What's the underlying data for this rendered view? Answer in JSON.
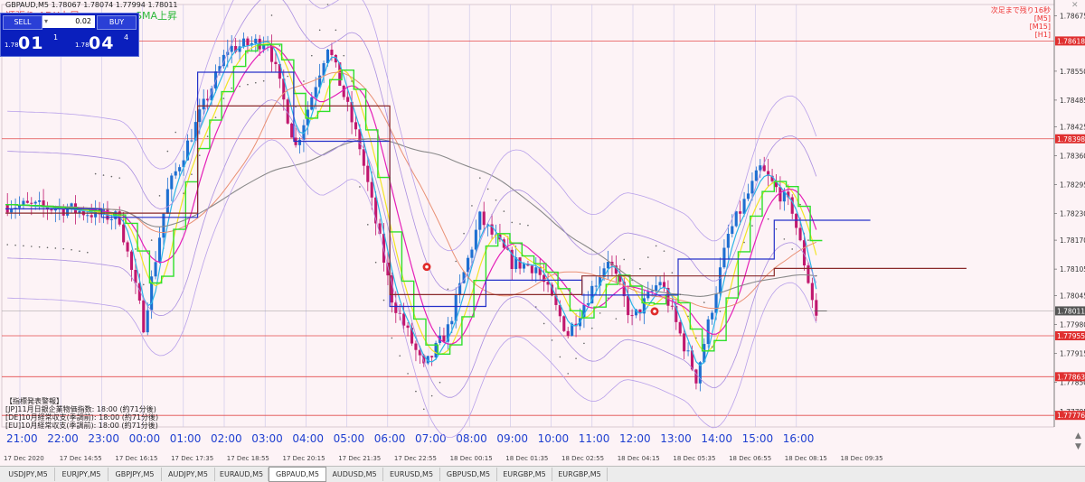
{
  "window": {
    "title": "GBPAUD,M5  1.78067 1.78074 1.77994 1.78011",
    "indicator_label_left": "順張り ADX上昇",
    "indicator_label_right": "SMA上昇",
    "countdown_lines": [
      "次足まで残り16秒",
      "[M5]",
      "[M15]",
      "[H1]"
    ]
  },
  "trade_panel": {
    "sell_label": "SELL",
    "buy_label": "BUY",
    "lot_value": "0.02",
    "sell_small": "1.78",
    "sell_big": "01",
    "sell_sup": "1",
    "buy_small": "1.78",
    "buy_big": "04",
    "buy_sup": "4"
  },
  "price_axis": {
    "ticks": [
      "1.78675",
      "1.78550",
      "1.78485",
      "1.78425",
      "1.78360",
      "1.78295",
      "1.78230",
      "1.78170",
      "1.78105",
      "1.78045",
      "1.77980",
      "1.77915",
      "1.77850",
      "1.77785"
    ],
    "labels": [
      {
        "text": "1.78618",
        "color": "#e03030"
      },
      {
        "text": "1.78398",
        "color": "#e03030"
      },
      {
        "text": "1.78011",
        "color": "#555555"
      },
      {
        "text": "1.77955",
        "color": "#e03030"
      },
      {
        "text": "1.77863",
        "color": "#e03030"
      },
      {
        "text": "1.77776",
        "color": "#e03030"
      }
    ]
  },
  "time_axis": {
    "hours": [
      "21:00",
      "22:00",
      "23:00",
      "00:00",
      "01:00",
      "02:00",
      "03:00",
      "04:00",
      "05:00",
      "06:00",
      "07:00",
      "08:00",
      "09:00",
      "10:00",
      "11:00",
      "12:00",
      "13:00",
      "14:00",
      "15:00",
      "16:00"
    ],
    "dates": [
      "17 Dec 2020",
      "17 Dec 14:55",
      "17 Dec 16:15",
      "17 Dec 17:35",
      "17 Dec 18:55",
      "17 Dec 20:15",
      "17 Dec 21:35",
      "17 Dec 22:55",
      "18 Dec 00:15",
      "18 Dec 01:35",
      "18 Dec 02:55",
      "18 Dec 04:15",
      "18 Dec 05:35",
      "18 Dec 06:55",
      "18 Dec 08:15",
      "18 Dec 09:35"
    ]
  },
  "news": {
    "title": "【指標発表警報】",
    "lines": [
      "[JP]11月日銀企業物価指数: 18:00 (約71分後)",
      "[DE]10月経常収支(季調前): 18:00 (約71分後)",
      "[EU]10月経常収支(季調前): 18:00 (約71分後)"
    ]
  },
  "tabs": [
    "USDJPY,M5",
    "EURJPY,M5",
    "GBPJPY,M5",
    "AUDJPY,M5",
    "EURAUD,M5",
    "GBPAUD,M5",
    "AUDUSD,M5",
    "EURUSD,M5",
    "GBPUSD,M5",
    "EURGBP,M5",
    "EURGBP,M5"
  ],
  "active_tab_index": 5,
  "chart_data": {
    "type": "candlestick",
    "symbol": "GBPAUD",
    "timeframe": "M5",
    "ylim": [
      1.7775,
      1.787
    ],
    "horizontal_levels": [
      1.78618,
      1.78398,
      1.77955,
      1.77863,
      1.77776
    ],
    "current_price": 1.78011,
    "colors": {
      "bull": "#1e6fd1",
      "bear": "#c0176e",
      "level": "#e34b4b",
      "bg": "#fdf3f6"
    }
  }
}
